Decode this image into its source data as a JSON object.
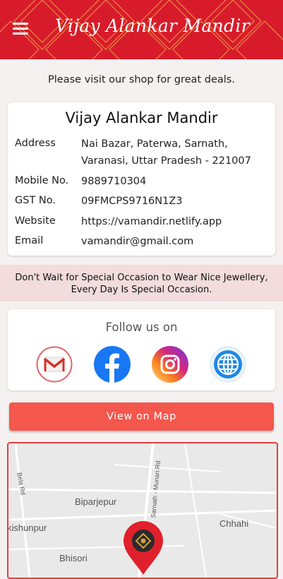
{
  "appbar": {
    "title": "Vijay Alankar Mandir"
  },
  "tagline": "Please visit our shop for great deals.",
  "shop": {
    "name": "Vijay Alankar Mandir",
    "rows": [
      {
        "label": "Address",
        "value": "Nai Bazar, Paterwa, Sarnath, Varanasi, Uttar Pradesh - 221007"
      },
      {
        "label": "Mobile No.",
        "value": "9889710304"
      },
      {
        "label": "GST No.",
        "value": "09FMCPS9716N1Z3"
      },
      {
        "label": "Website",
        "value": "https://vamandir.netlify.app"
      },
      {
        "label": "Email",
        "value": "vamandir@gmail.com"
      }
    ]
  },
  "promo": {
    "line1": "Don't Wait for Special Occasion to Wear Nice Jewellery,",
    "line2": "Every Day Is Special Occasion."
  },
  "follow": {
    "title": "Follow us on",
    "icons": [
      "gmail-icon",
      "facebook-icon",
      "instagram-icon",
      "website-globe-icon"
    ]
  },
  "map_button": {
    "label": "View on Map"
  },
  "map": {
    "labels": {
      "road1": "Bela Rd",
      "road2": "Sarnath - Munari Rd",
      "place1": "Biparjepur",
      "place2": "Chhahi",
      "place3": "kishunpur",
      "place4": "Bhisori"
    }
  },
  "colors": {
    "primary": "#d81b2b",
    "button": "#f4574c",
    "promo_bg": "#f2dcdc",
    "background": "#f6f1f1"
  }
}
